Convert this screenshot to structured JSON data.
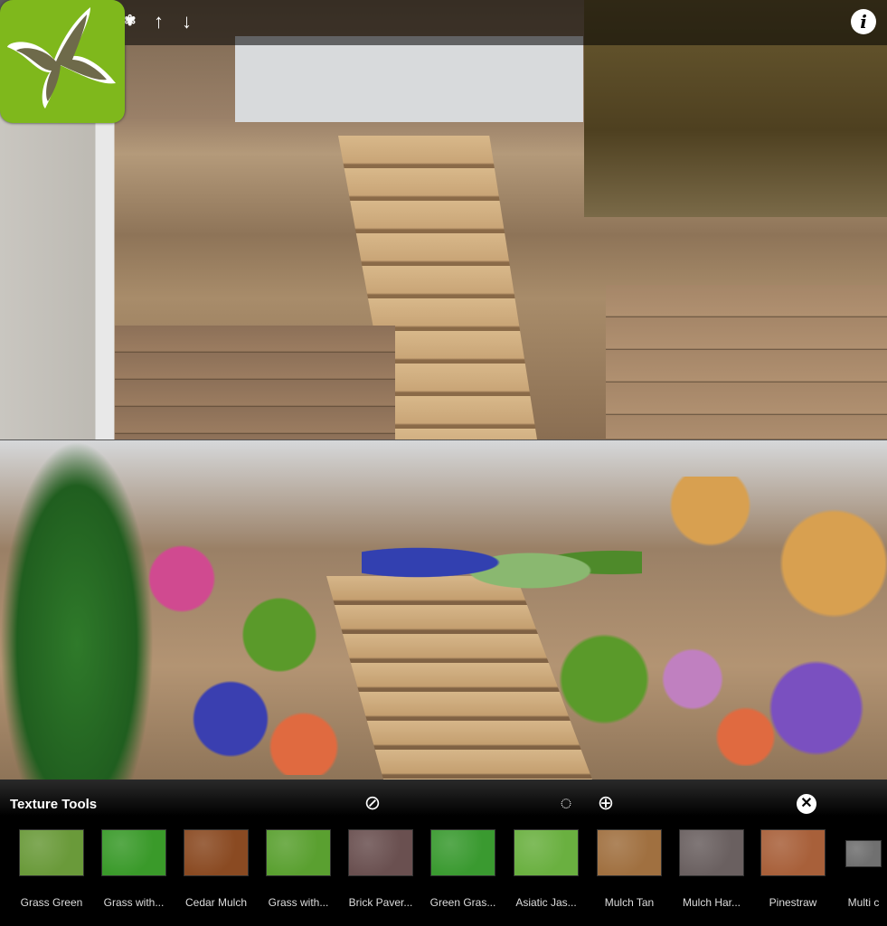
{
  "header": {
    "icons": [
      "plant-icon",
      "arrow-up-icon",
      "arrow-down-icon",
      "info-icon"
    ]
  },
  "panel": {
    "title": "Texture Tools",
    "tools": [
      "eraser-selection-icon",
      "delete-selection-icon",
      "add-page-icon",
      "close-icon"
    ],
    "textures": [
      {
        "label": "Grass Green",
        "color": "#6a9a3a"
      },
      {
        "label": "Grass with...",
        "color": "#3a9a2a"
      },
      {
        "label": "Cedar Mulch",
        "color": "#8a4a22"
      },
      {
        "label": "Grass with...",
        "color": "#5aa030"
      },
      {
        "label": "Brick Paver...",
        "color": "#6a5050"
      },
      {
        "label": "Green Gras...",
        "color": "#3a9a30"
      },
      {
        "label": "Asiatic Jas...",
        "color": "#6ab040"
      },
      {
        "label": "Mulch Tan",
        "color": "#a07040"
      },
      {
        "label": "Mulch Har...",
        "color": "#6a6060"
      },
      {
        "label": "Pinestraw",
        "color": "#a8603a"
      },
      {
        "label": "Multi c",
        "color": "#707070"
      }
    ]
  }
}
